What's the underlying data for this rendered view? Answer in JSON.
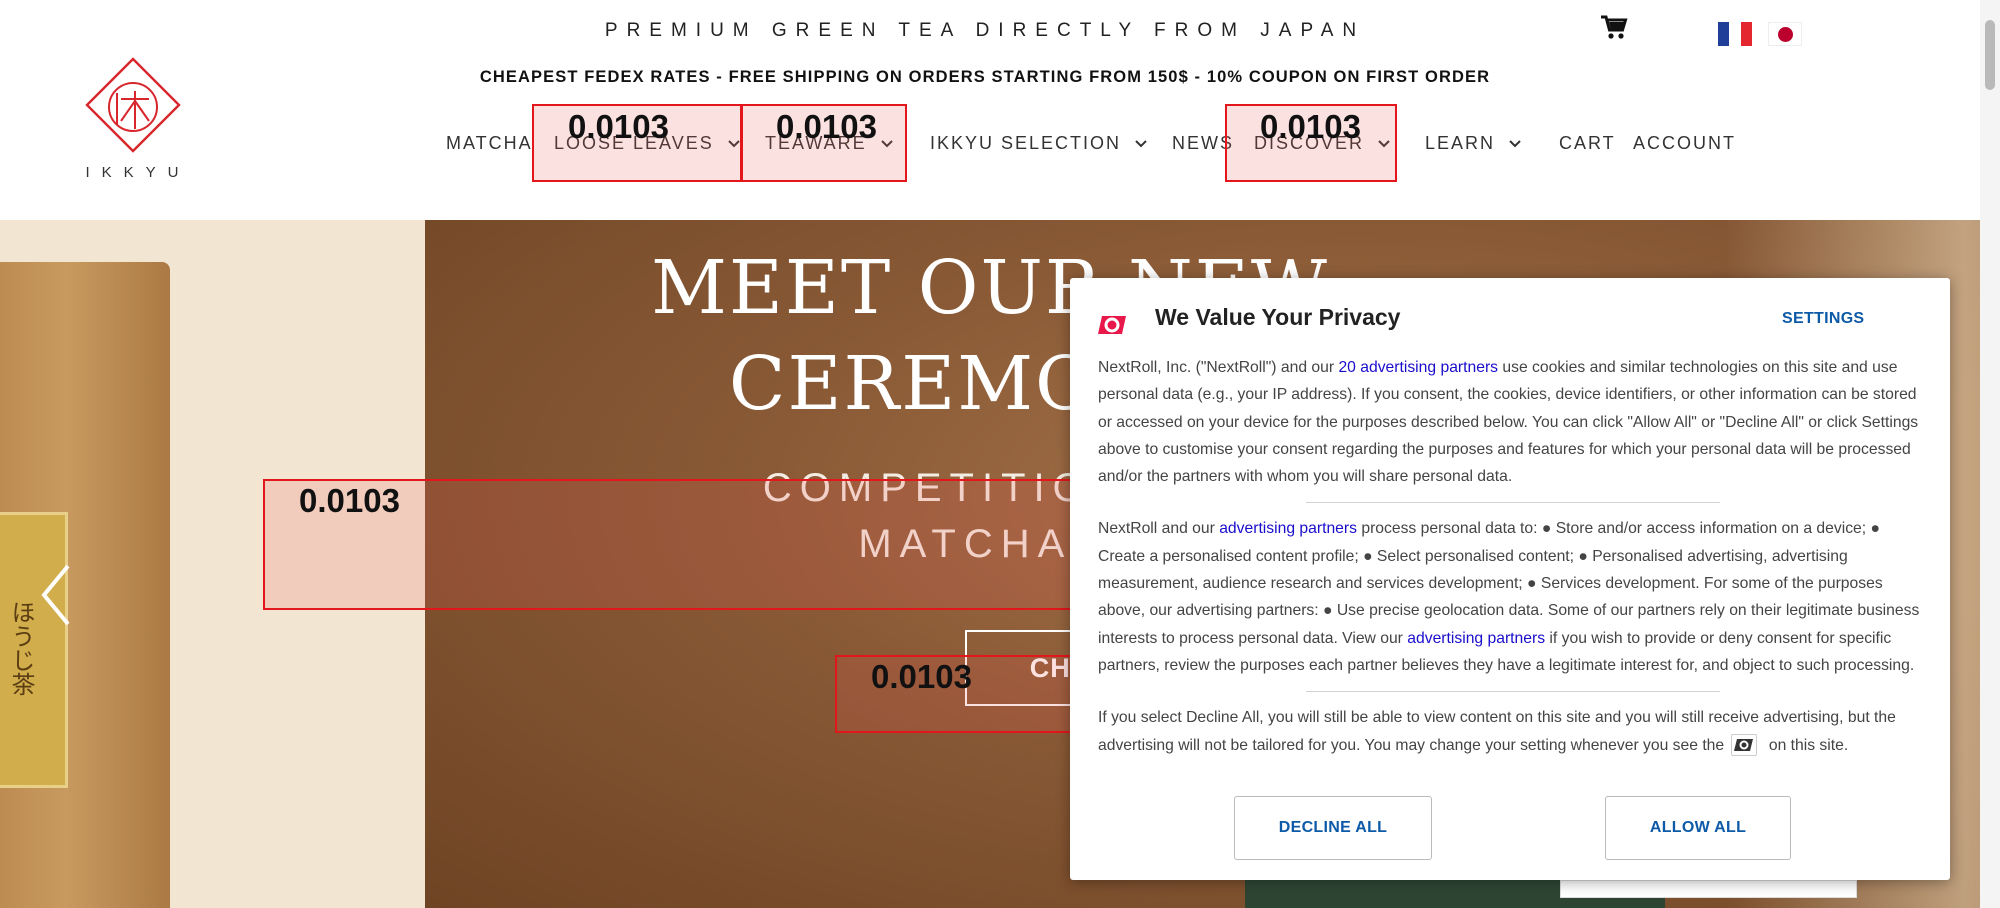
{
  "header": {
    "banner": "PREMIUM GREEN TEA DIRECTLY FROM JAPAN",
    "shipping": "CHEAPEST FEDEX RATES - FREE SHIPPING ON ORDERS STARTING FROM 150$ - 10% COUPON ON FIRST ORDER",
    "logo_text": "IKKYU",
    "icons": {
      "cart": "cart-icon",
      "flag_fr": "flag-france-icon",
      "flag_jp": "flag-japan-icon"
    },
    "nav": [
      {
        "label": "MATCHA",
        "dropdown": false
      },
      {
        "label": "LOOSE LEAVES",
        "dropdown": true
      },
      {
        "label": "TEAWARE",
        "dropdown": true
      },
      {
        "label": "IKKYU SELECTION",
        "dropdown": true
      },
      {
        "label": "NEWS",
        "dropdown": false
      },
      {
        "label": "DISCOVER",
        "dropdown": true
      },
      {
        "label": "LEARN",
        "dropdown": true
      },
      {
        "label": "CART",
        "dropdown": false
      },
      {
        "label": "ACCOUNT",
        "dropdown": false
      }
    ]
  },
  "annotations": [
    {
      "score": "0.0103"
    },
    {
      "score": "0.0103"
    },
    {
      "score": "0.0103"
    },
    {
      "score": "0.0103"
    },
    {
      "score": "0.0103"
    }
  ],
  "hero": {
    "title_line1": "MEET OUR NEW",
    "title_line2": "CEREMONIA",
    "sub_line1": "COMPETITION AN",
    "sub_line2": "MATCHA F",
    "cta": "CHEC",
    "bag_kanji": "ほうじ茶"
  },
  "privacy": {
    "title": "We Value Your Privacy",
    "settings": "SETTINGS",
    "p1_a": "NextRoll, Inc. (\"NextRoll\") and our ",
    "p1_link": "20 advertising partners",
    "p1_b": " use cookies and similar technologies on this site and use personal data (e.g., your IP address). If you consent, the cookies, device identifiers, or other information can be stored or accessed on your device for the purposes described below. You can click \"Allow All\" or \"Decline All\" or click Settings above to customise your consent regarding the purposes and features for which your personal data will be processed and/or the partners with whom you will share personal data.",
    "p2_a": "NextRoll and our ",
    "p2_link1": "advertising partners",
    "p2_b": " process personal data to: ● Store and/or access information on a device; ● Create a personalised content profile; ● Select personalised content; ● Personalised advertising, advertising measurement, audience research and services development; ● Services development. For some of the purposes above, our advertising partners: ● Use precise geolocation data. Some of our partners rely on their legitimate business interests to process personal data. View our ",
    "p2_link2": "advertising partners",
    "p2_c": " if you wish to provide or deny consent for specific partners, review the purposes each partner believes they have a legitimate interest for, and object to such processing.",
    "p3_a": "If you select Decline All, you will still be able to view content on this site and you will still receive advertising, but the advertising will not be tailored for you. You may change your setting whenever you see the ",
    "p3_b": " on this site.",
    "decline": "DECLINE ALL",
    "allow": "ALLOW ALL"
  },
  "colors": {
    "brand_red": "#d8262c",
    "modal_link": "#0d5aa7",
    "annotation": "#e3161b"
  }
}
